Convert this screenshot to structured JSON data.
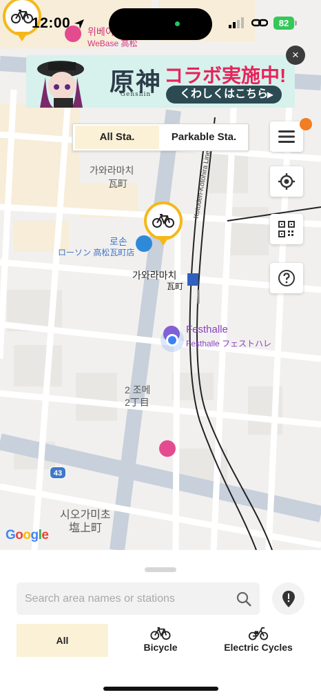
{
  "status_bar": {
    "time": "12:00",
    "battery": "82"
  },
  "banner": {
    "logo_main": "原神",
    "logo_sub": "Genshin",
    "headline": "コラボ実施中!",
    "cta": "くわしくはこちら",
    "close_label": "×"
  },
  "station_toggle": {
    "options": [
      "All Sta.",
      "Parkable Sta."
    ],
    "selected": "All Sta."
  },
  "map": {
    "labels": {
      "kawaramachi_ko": "가와라마치",
      "kawaramachi_ja": "瓦町",
      "kawaramachi_station_ko": "가와라마치",
      "kawaramachi_station_ja": "瓦町",
      "nichome_ko": "2 조메",
      "nichome_ja": "2丁目",
      "shiogamicho_ko": "시오가미초",
      "shiogamicho_ja": "塩上町",
      "kotoden_line": "Kotoden-Kotohira Line",
      "route_number": "43"
    },
    "pois": {
      "webase_ko": "위베이",
      "webase_ja": "WeBase 高松",
      "lawson_ko": "로손",
      "lawson_ja": "ローソン 高松瓦町店",
      "festhalle": "Festhalle",
      "festhalle_ja": "Festhalle フェストハレ"
    },
    "google": [
      "G",
      "o",
      "o",
      "g",
      "l",
      "e"
    ]
  },
  "colors": {
    "accent_yellow": "#f4b81a",
    "selected_bg": "#fbf1d6",
    "notify": "#f17e23",
    "banner_pink": "#e6245c"
  },
  "bottom_sheet": {
    "search_placeholder": "Search area names or stations",
    "tabs": [
      "All",
      "Bicycle",
      "Electric Cycles"
    ],
    "selected_tab": "All"
  }
}
